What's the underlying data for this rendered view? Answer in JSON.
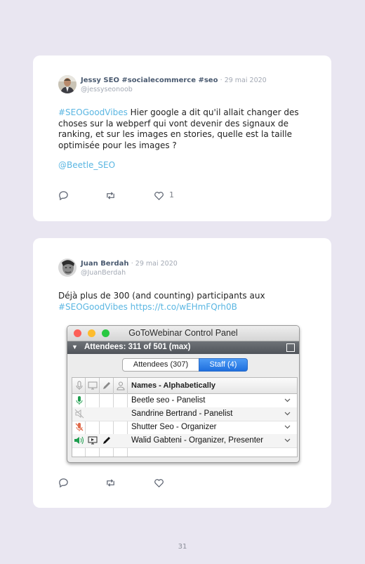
{
  "tweets": [
    {
      "author": "Jessy SEO #socialecommerce #seo",
      "date": "· 29 mai 2020",
      "handle": "@jessyseonoob",
      "text_link": "#SEOGoodVibes",
      "text": " Hier google a dit qu'il allait changer des choses sur la webperf qui vont devenir des signaux de ranking, et sur les images en stories, quelle est la taille optimisée pour les images ?",
      "mention": "@Beetle_SEO",
      "likes": "1",
      "avatar_icon": "person-photo-icon"
    },
    {
      "author": "Juan Berdah",
      "date": "· 29 mai 2020",
      "handle": "@JuanBerdah",
      "text_line1": "Déjà plus de 300 (and counting) participants aux",
      "hashtag": "#SEOGoodVibes",
      "url": "https://t.co/wEHmFQrh0B",
      "avatar_icon": "person-photo-icon"
    }
  ],
  "panel": {
    "title": "GoToWebinar Control Panel",
    "attendees_header": "Attendees: 311 of 501 (max)",
    "tab_attendees": "Attendees (307)",
    "tab_staff": "Staff (4)",
    "column_names": "Names - Alphabetically",
    "rows": [
      {
        "name": "Beetle seo - Panelist"
      },
      {
        "name": "Sandrine Bertrand - Panelist"
      },
      {
        "name": "Shutter Seo - Organizer"
      },
      {
        "name": "Walid Gabteni - Organizer, Presenter"
      }
    ],
    "colors": {
      "close": "#fc5f57",
      "minimize": "#fdbc2e",
      "zoom": "#29c841",
      "staff_tab": "#1f6fde",
      "mic_active": "#1f9e4f",
      "mic_muted": "#e06a4a"
    }
  },
  "page_number": "31",
  "colors": {
    "background": "#e9e6f1",
    "card": "#ffffff",
    "link": "#5ab6e2"
  }
}
